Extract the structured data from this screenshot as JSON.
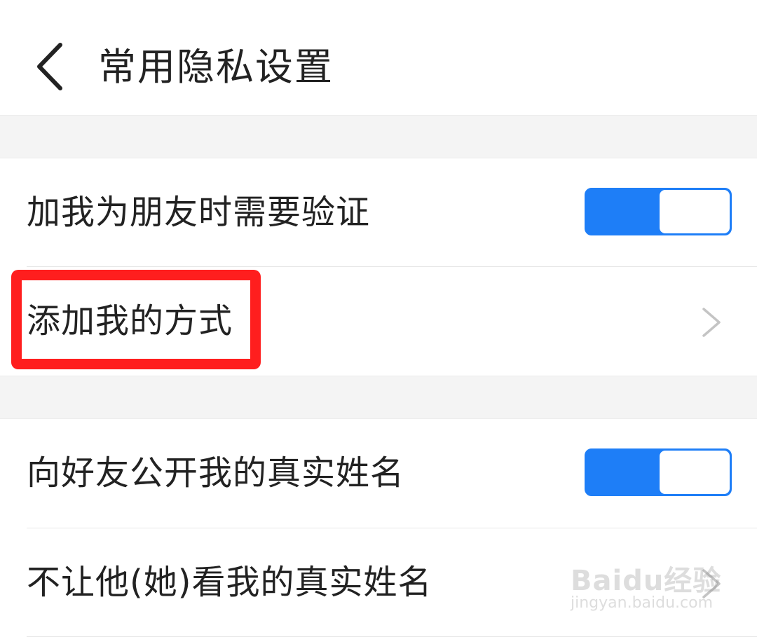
{
  "header": {
    "title": "常用隐私设置",
    "back_icon": "chevron-left-icon"
  },
  "rows": [
    {
      "label": "加我为朋友时需要验证",
      "control": "toggle",
      "on": true
    },
    {
      "label": "添加我的方式",
      "control": "chevron",
      "highlighted": true
    },
    {
      "label": "向好友公开我的真实姓名",
      "control": "toggle",
      "on": true
    },
    {
      "label": "不让他(她)看我的真实姓名",
      "control": "chevron"
    }
  ],
  "watermark": {
    "brand": "Baidu经验",
    "url": "jingyan.baidu.com"
  },
  "colors": {
    "accent": "#1e7ef7",
    "highlight": "#ff1e1e",
    "section_gap": "#f4f4f4",
    "text": "#222222"
  }
}
